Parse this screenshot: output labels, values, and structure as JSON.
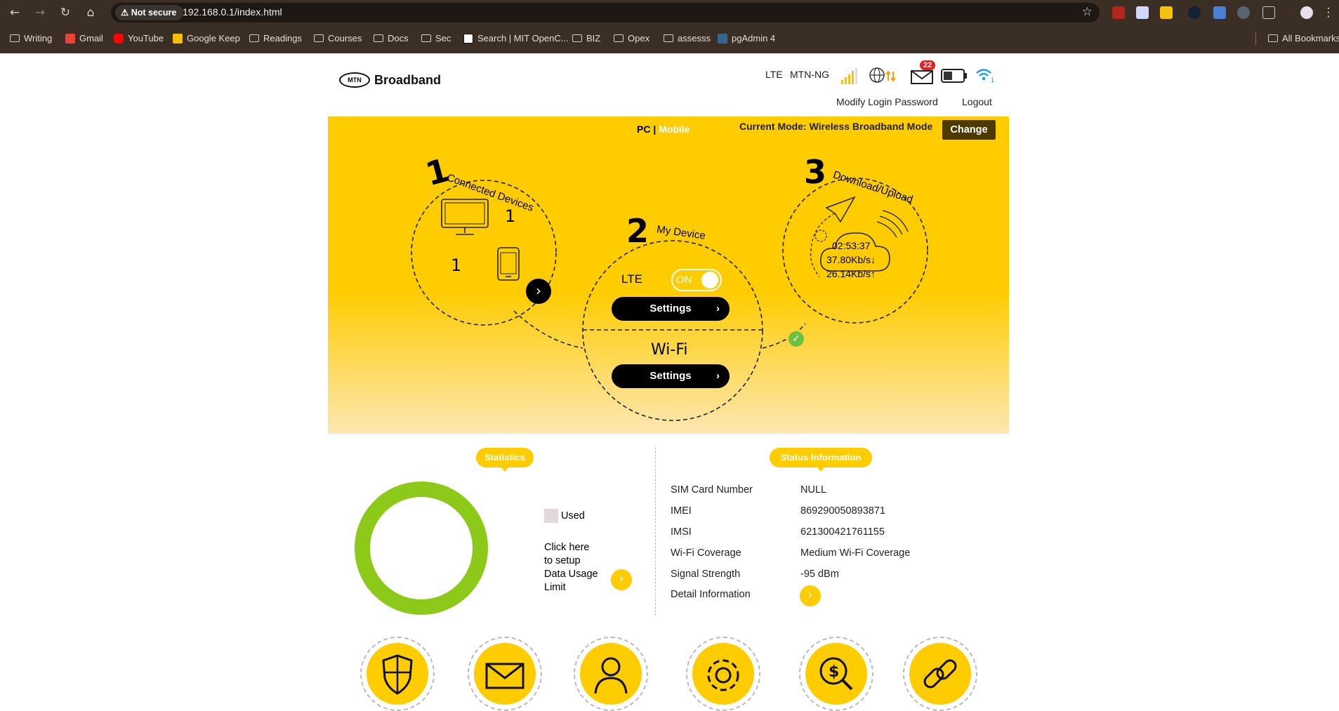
{
  "browser": {
    "security_chip": "Not secure",
    "url": "192.168.0.1/index.html",
    "bookmarks": [
      {
        "label": "Writing",
        "icon": "folder-icon"
      },
      {
        "label": "Gmail",
        "icon": "gmail-icon"
      },
      {
        "label": "YouTube",
        "icon": "youtube-icon"
      },
      {
        "label": "Google Keep",
        "icon": "keep-icon"
      },
      {
        "label": "Readings",
        "icon": "folder-icon"
      },
      {
        "label": "Courses",
        "icon": "folder-icon"
      },
      {
        "label": "Docs",
        "icon": "folder-icon"
      },
      {
        "label": "Sec",
        "icon": "folder-icon"
      },
      {
        "label": "Search | MIT OpenC...",
        "icon": "mit-icon"
      },
      {
        "label": "BIZ",
        "icon": "folder-icon"
      },
      {
        "label": "Opex",
        "icon": "folder-icon"
      },
      {
        "label": "assesss",
        "icon": "folder-icon"
      },
      {
        "label": "pgAdmin 4",
        "icon": "pgadmin-icon"
      }
    ],
    "all_bookmarks": "All Bookmarks"
  },
  "header": {
    "logo_badge": "MTN",
    "logo_text": "Broadband",
    "network_type": "LTE",
    "operator": "MTN-NG",
    "unread_messages": "22",
    "modify_password": "Modify Login Password",
    "logout": "Logout"
  },
  "banner": {
    "view_pc": "PC",
    "view_sep": "|",
    "view_mobile": "Mobile",
    "current_mode": "Current Mode: Wireless Broadband Mode",
    "change_button": "Change",
    "step1_num": "1",
    "step1_title": "Connected Devices",
    "pc_count": "1",
    "mobile_count": "1",
    "step2_num": "2",
    "step2_title": "My Device",
    "lte_label": "LTE",
    "lte_toggle": "ON",
    "settings_lte": "Settings",
    "wifi_label": "Wi-Fi",
    "settings_wifi": "Settings",
    "step3_num": "3",
    "step3_title": "Download/Upload",
    "duration": "02:53:37",
    "download": "37.80Kb/s↓",
    "upload": "26.14Kb/s↑"
  },
  "statistics": {
    "title": "Statistics",
    "legend_used": "Used",
    "setup_line1": "Click here",
    "setup_line2": "to setup",
    "setup_line3": "Data Usage",
    "setup_line4": "Limit",
    "used_fraction": 0
  },
  "status": {
    "title": "Status Information",
    "rows": [
      {
        "label": "SIM Card Number",
        "value": "NULL"
      },
      {
        "label": "IMEI",
        "value": "869290050893871"
      },
      {
        "label": "IMSI",
        "value": "621300421761155"
      },
      {
        "label": "Wi-Fi Coverage",
        "value": "Medium Wi-Fi Coverage"
      },
      {
        "label": "Signal Strength",
        "value": "-95 dBm"
      },
      {
        "label": "Detail Information",
        "value": ""
      }
    ]
  },
  "colors": {
    "accent": "#ffcc00",
    "donut": "#8dc919",
    "chrome": "#3b2e25"
  }
}
